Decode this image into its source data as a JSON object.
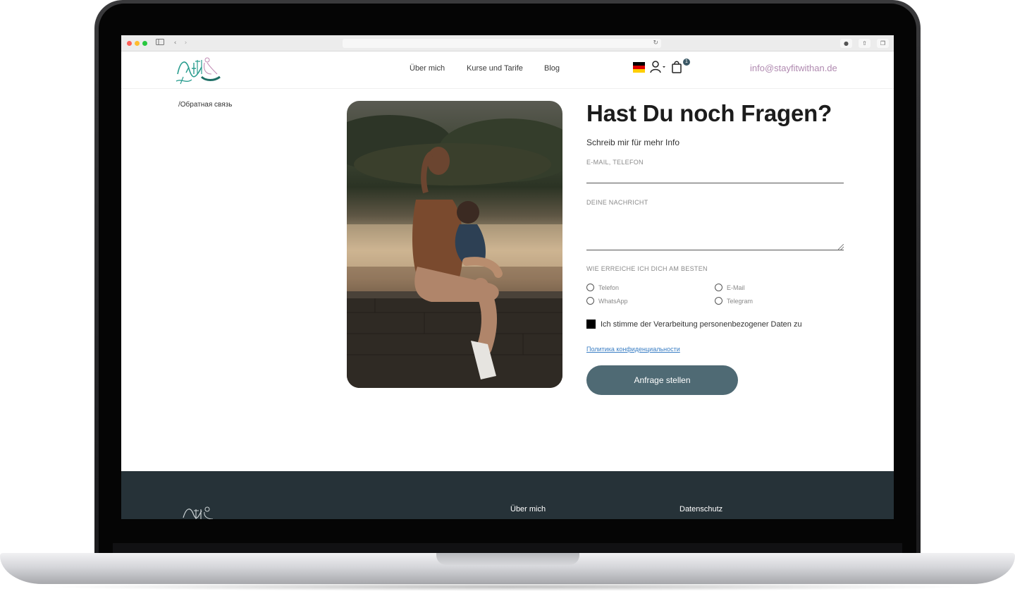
{
  "header": {
    "nav": {
      "about": "Über mich",
      "courses": "Kurse und Tarife",
      "blog": "Blog"
    },
    "cart_count": "1",
    "email": "info@stayfitwithan.de",
    "language": "de"
  },
  "breadcrumb": "/Обратная связь",
  "form": {
    "title": "Hast Du noch Fragen?",
    "subtitle": "Schreib mir für mehr Info",
    "contact_label": "E-MAIL, TELEFON",
    "message_label": "DEINE NACHRICHT",
    "reach_label": "WIE ERREICHE ICH DICH AM BESTEN",
    "options": {
      "phone": "Telefon",
      "whatsapp": "WhatsApp",
      "email": "E-Mail",
      "telegram": "Telegram"
    },
    "consent": "Ich stimme der Verarbeitung personenbezogener Daten zu",
    "privacy_link": "Политика конфиденциальности",
    "submit": "Anfrage stellen"
  },
  "footer": {
    "about": "Über mich",
    "privacy": "Datenschutz"
  },
  "colors": {
    "accent": "#4f6a74",
    "email_link": "#b08ab0",
    "footer_bg": "#263238",
    "logo_teal": "#2a9d8f"
  },
  "icons": [
    "sidebar-icon",
    "back-arrow-icon",
    "forward-arrow-icon",
    "reload-icon",
    "download-icon",
    "share-icon",
    "tabs-icon",
    "german-flag-icon",
    "user-icon",
    "cart-icon"
  ]
}
